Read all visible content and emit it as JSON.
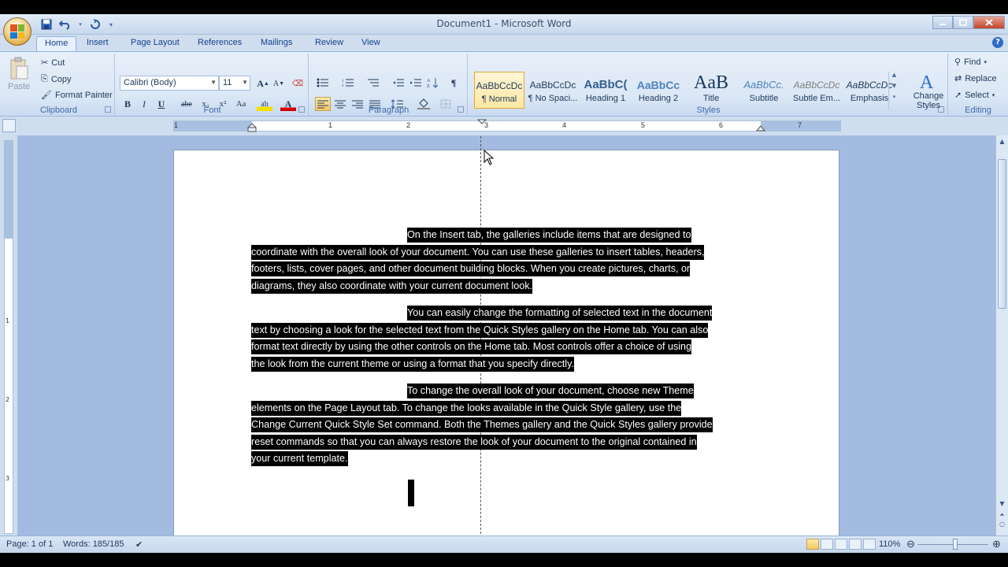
{
  "window": {
    "title": "Document1 - Microsoft Word",
    "controls": {
      "minimize": "–",
      "maximize": "□",
      "close": "✕"
    }
  },
  "qat": {
    "save_icon": "save-icon",
    "undo_icon": "undo-icon",
    "redo_icon": "redo-icon"
  },
  "tabs": [
    {
      "label": "Home",
      "active": true
    },
    {
      "label": "Insert"
    },
    {
      "label": "Page Layout"
    },
    {
      "label": "References"
    },
    {
      "label": "Mailings"
    },
    {
      "label": "Review"
    },
    {
      "label": "View"
    }
  ],
  "clipboard": {
    "paste": "Paste",
    "cut": "Cut",
    "copy": "Copy",
    "format_painter": "Format Painter",
    "label": "Clipboard"
  },
  "font": {
    "name": "Calibri (Body)",
    "size": "11",
    "label": "Font",
    "bold": "B",
    "italic": "I",
    "underline": "U",
    "strike": "abe",
    "subscript": "x₂",
    "superscript": "x²",
    "change_case": "Aa",
    "grow": "A",
    "shrink": "A",
    "highlight": "ab",
    "color": "A"
  },
  "paragraph": {
    "label": "Paragraph",
    "pilcrow": "¶"
  },
  "styles": {
    "label": "Styles",
    "items": [
      {
        "sample": "AaBbCcDc",
        "name": "¶ Normal",
        "selected": true
      },
      {
        "sample": "AaBbCcDc",
        "name": "¶ No Spaci..."
      },
      {
        "sample": "AaBbC(",
        "name": "Heading 1"
      },
      {
        "sample": "AaBbCc",
        "name": "Heading 2"
      },
      {
        "sample": "AaB",
        "name": "Title"
      },
      {
        "sample": "AaBbCc.",
        "name": "Subtitle"
      },
      {
        "sample": "AaBbCcDc",
        "name": "Subtle Em..."
      },
      {
        "sample": "AaBbCcDc",
        "name": "Emphasis"
      }
    ],
    "change_styles": "Change Styles"
  },
  "editing": {
    "find": "Find",
    "replace": "Replace",
    "select": "Select",
    "label": "Editing"
  },
  "ruler": {
    "numbers": [
      "1",
      "1",
      "2",
      "3",
      "4",
      "5",
      "6",
      "7"
    ]
  },
  "vruler": {
    "numbers": [
      "1",
      "2",
      "3"
    ]
  },
  "document": {
    "paragraphs": [
      {
        "first": "On the Insert tab, the galleries include items that are designed to",
        "lines": [
          "coordinate with the overall look of your document. You can use these galleries to insert tables, headers,",
          "footers, lists, cover pages, and other document building blocks. When you create pictures, charts, or",
          "diagrams, they also coordinate with your current document look."
        ]
      },
      {
        "first": "You can easily change the formatting of selected text in the document",
        "lines": [
          "text by choosing a look for the selected text from the Quick Styles gallery on the Home tab. You can also",
          "format text directly by using the other controls on the Home tab. Most controls offer a choice of using",
          "the look from the current theme or using a format that you specify directly."
        ]
      },
      {
        "first": "To change the overall look of your document, choose new Theme",
        "lines": [
          "elements on the Page Layout tab. To change the looks available in the Quick Style gallery, use the",
          "Change Current Quick Style Set command. Both the Themes gallery and the Quick Styles gallery provide",
          "reset commands so that you can always restore the look of your document to the original contained in",
          "your current template."
        ]
      }
    ]
  },
  "status": {
    "page": "Page: 1 of 1",
    "words": "Words: 185/185",
    "zoom": "110%",
    "zoom_out": "⊖",
    "zoom_in": "⊕"
  },
  "colors": {
    "selection": "#000000",
    "ribbon": "#dbe7f5",
    "doc_background": "#a3bbe0",
    "accent": "#15428b"
  }
}
